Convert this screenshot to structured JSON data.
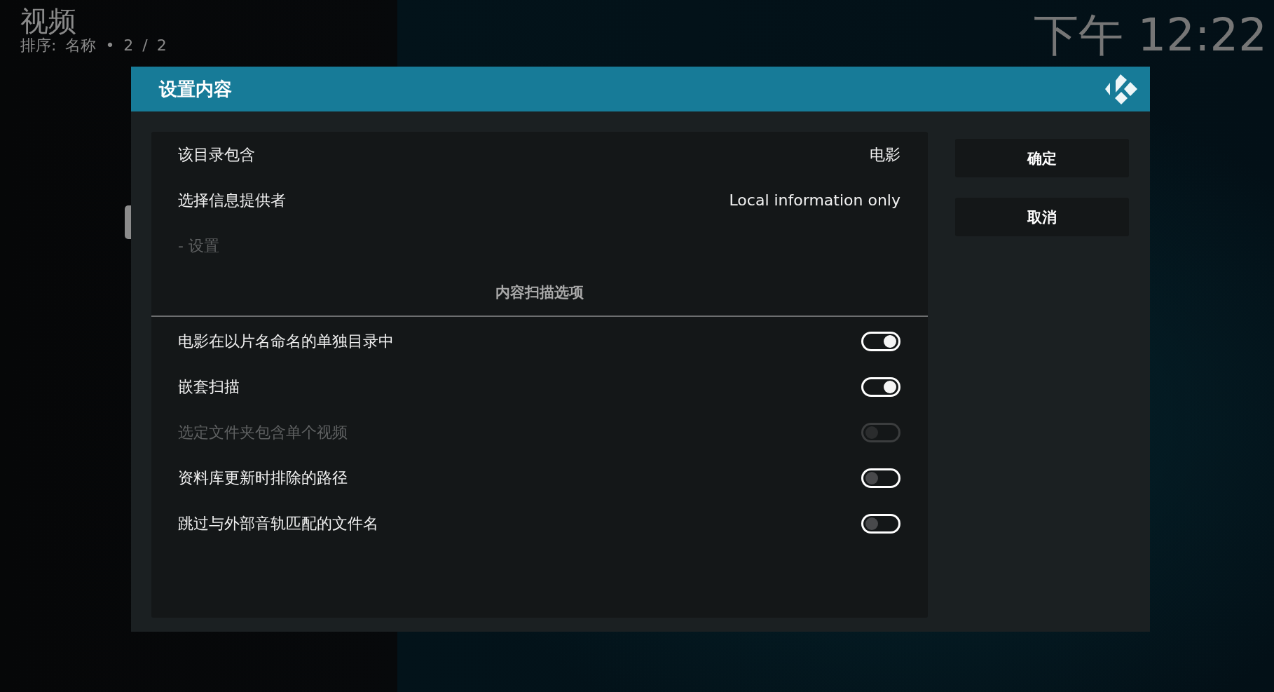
{
  "header": {
    "title": "视频",
    "subtitle": "排序: 名称 • 2 / 2"
  },
  "clock": "下午 12:22",
  "dialog": {
    "title": "设置内容",
    "settings": [
      {
        "kind": "value",
        "label": "该目录包含",
        "value": "电影",
        "disabled": false
      },
      {
        "kind": "value",
        "label": "选择信息提供者",
        "value": "Local information only",
        "disabled": false
      },
      {
        "kind": "link",
        "label": "- 设置",
        "disabled": true
      },
      {
        "kind": "section",
        "label": "内容扫描选项"
      },
      {
        "kind": "toggle",
        "label": "电影在以片名命名的单独目录中",
        "on": true,
        "disabled": false
      },
      {
        "kind": "toggle",
        "label": "嵌套扫描",
        "on": true,
        "disabled": false
      },
      {
        "kind": "toggle",
        "label": "选定文件夹包含单个视频",
        "on": false,
        "disabled": true
      },
      {
        "kind": "toggle",
        "label": "资料库更新时排除的路径",
        "on": false,
        "disabled": false
      },
      {
        "kind": "toggle",
        "label": "跳过与外部音轨匹配的文件名",
        "on": false,
        "disabled": false
      }
    ],
    "buttons": [
      "确定",
      "取消"
    ]
  }
}
